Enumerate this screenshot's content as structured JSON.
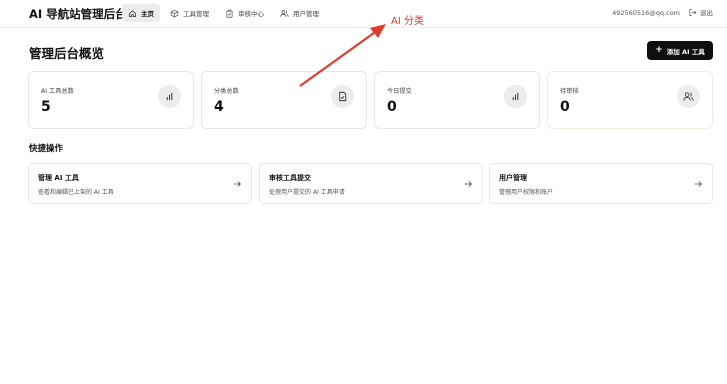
{
  "app": {
    "title": "AI 导航站管理后台"
  },
  "nav": {
    "items": [
      {
        "label": "主页",
        "icon": "home-icon",
        "active": true
      },
      {
        "label": "工具管理",
        "icon": "package-icon",
        "active": false
      },
      {
        "label": "审核中心",
        "icon": "clipboard-icon",
        "active": false
      },
      {
        "label": "用户管理",
        "icon": "users-icon",
        "active": false
      }
    ],
    "user_email": "492560516@qq.com",
    "logout_label": "退出"
  },
  "page": {
    "title": "管理后台概览",
    "add_button_label": "添加 AI 工具"
  },
  "stats": [
    {
      "label": "AI 工具总数",
      "value": "5",
      "icon": "bar-chart-icon"
    },
    {
      "label": "分类总数",
      "value": "4",
      "icon": "file-check-icon"
    },
    {
      "label": "今日提交",
      "value": "0",
      "icon": "bar-chart-icon"
    },
    {
      "label": "待审核",
      "value": "0",
      "icon": "users-icon"
    }
  ],
  "quick_actions": {
    "title": "快捷操作",
    "items": [
      {
        "title": "管理 AI 工具",
        "desc": "查看和编辑已上架的 AI 工具"
      },
      {
        "title": "审核工具提交",
        "desc": "处理用户提交的 AI 工具申请"
      },
      {
        "title": "用户管理",
        "desc": "管理用户权限和账户"
      }
    ]
  },
  "annotation": {
    "label": "AI 分类",
    "color": "#e3392b"
  },
  "colors": {
    "accent": "#0f0f0f",
    "icon_bg": "#ececec",
    "annotation": "#e3392b"
  }
}
